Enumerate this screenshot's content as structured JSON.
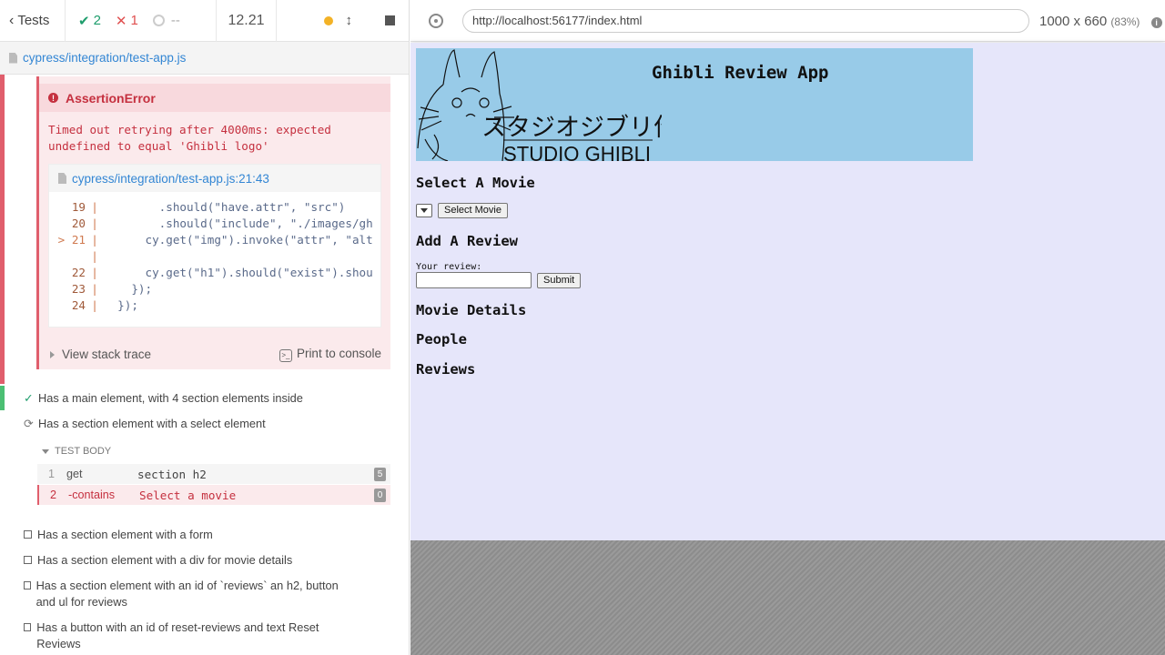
{
  "runner": {
    "tests_label": "Tests",
    "passed": "2",
    "failed": "1",
    "pending": "--",
    "duration": "12.21",
    "spec_file": "cypress/integration/test-app.js"
  },
  "error": {
    "name": "AssertionError",
    "message": "Timed out retrying after 4000ms: expected\nundefined to equal 'Ghibli logo'",
    "location": "cypress/integration/test-app.js:21:43",
    "code_lines": [
      {
        "num": "19",
        "code": "        .should(\"have.attr\", \"src\")"
      },
      {
        "num": "20",
        "code": "        .should(\"include\", \"./images/gh"
      },
      {
        "num": "> 21",
        "code": "      cy.get(\"img\").invoke(\"attr\", \"alt"
      },
      {
        "num": "",
        "code": ""
      },
      {
        "num": "22",
        "code": "      cy.get(\"h1\").should(\"exist\").shou"
      },
      {
        "num": "23",
        "code": "    });"
      },
      {
        "num": "24",
        "code": "  });"
      }
    ],
    "view_stack": "View stack trace",
    "print_console": "Print to console"
  },
  "tests": {
    "passed_test": "Has a main element, with 4 section elements inside",
    "running_test": "Has a section element with a select element",
    "test_body_label": "TEST BODY",
    "commands": [
      {
        "num": "1",
        "name": "get",
        "msg": "section h2",
        "count": "5"
      },
      {
        "num": "2",
        "name": "-contains",
        "msg": "Select a movie",
        "count": "0"
      }
    ],
    "queued": [
      "Has a section element with a form",
      "Has a section element with a div for movie details",
      "Has a section element with an id of `reviews` an h2, button and ul for reviews",
      "Has a button with an id of reset-reviews and text Reset Reviews"
    ]
  },
  "browser": {
    "url": "http://localhost:56177/index.html",
    "size": "1000 x 660",
    "scale": "(83%)"
  },
  "app": {
    "title": "Ghibli Review App",
    "logo_text_jp": "スタジオジブリ作品",
    "logo_text_en": "STUDIO GHIBLI",
    "select_heading": "Select A Movie",
    "select_button": "Select Movie",
    "review_heading": "Add A Review",
    "review_label": "Your review:",
    "submit": "Submit",
    "details_heading": "Movie Details",
    "people_heading": "People",
    "reviews_heading": "Reviews"
  },
  "colors": {
    "pass": "#1e9d6c",
    "fail": "#e05050",
    "app_bg": "#e6e6fa",
    "header_bg": "#98cbe8"
  }
}
